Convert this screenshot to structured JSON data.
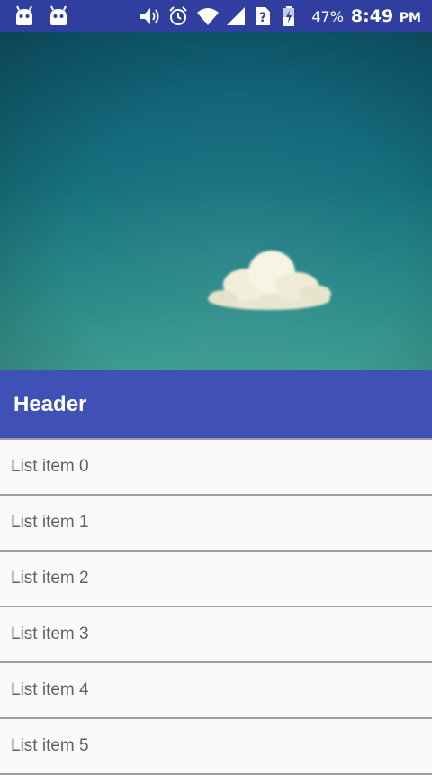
{
  "status_bar": {
    "notification_icons": [
      "android-icon",
      "android-icon"
    ],
    "system_icons": [
      "volume-icon",
      "alarm-icon",
      "wifi-icon",
      "signal-icon",
      "unknown-sim-icon",
      "battery-charging-icon"
    ],
    "battery_percent": "47%",
    "time": "8:49",
    "ampm": "PM",
    "color": "#303f9f"
  },
  "hero": {
    "image": "sky-with-cloud",
    "colors": {
      "top": "#0f5c73",
      "bottom": "#3e9c91",
      "cloud": "#f3f0dc"
    }
  },
  "header": {
    "title": "Header",
    "color": "#3f51b5"
  },
  "list": {
    "items": [
      {
        "label": "List item 0"
      },
      {
        "label": "List item 1"
      },
      {
        "label": "List item 2"
      },
      {
        "label": "List item 3"
      },
      {
        "label": "List item 4"
      },
      {
        "label": "List item 5"
      }
    ]
  }
}
